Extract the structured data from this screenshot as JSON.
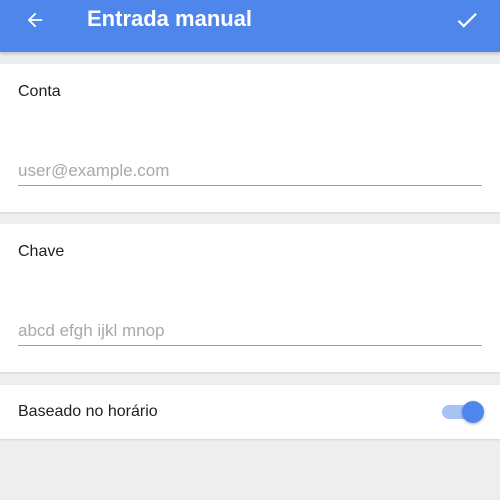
{
  "app_bar": {
    "title": "Entrada manual",
    "back_icon": "arrow-left-icon",
    "done_icon": "check-icon",
    "color": "#4f86ec"
  },
  "account": {
    "label": "Conta",
    "value": "",
    "placeholder": "user@example.com"
  },
  "key": {
    "label": "Chave",
    "value": "",
    "placeholder": "abcd efgh ijkl mnop"
  },
  "time_based": {
    "label": "Baseado no horário",
    "enabled": true
  }
}
